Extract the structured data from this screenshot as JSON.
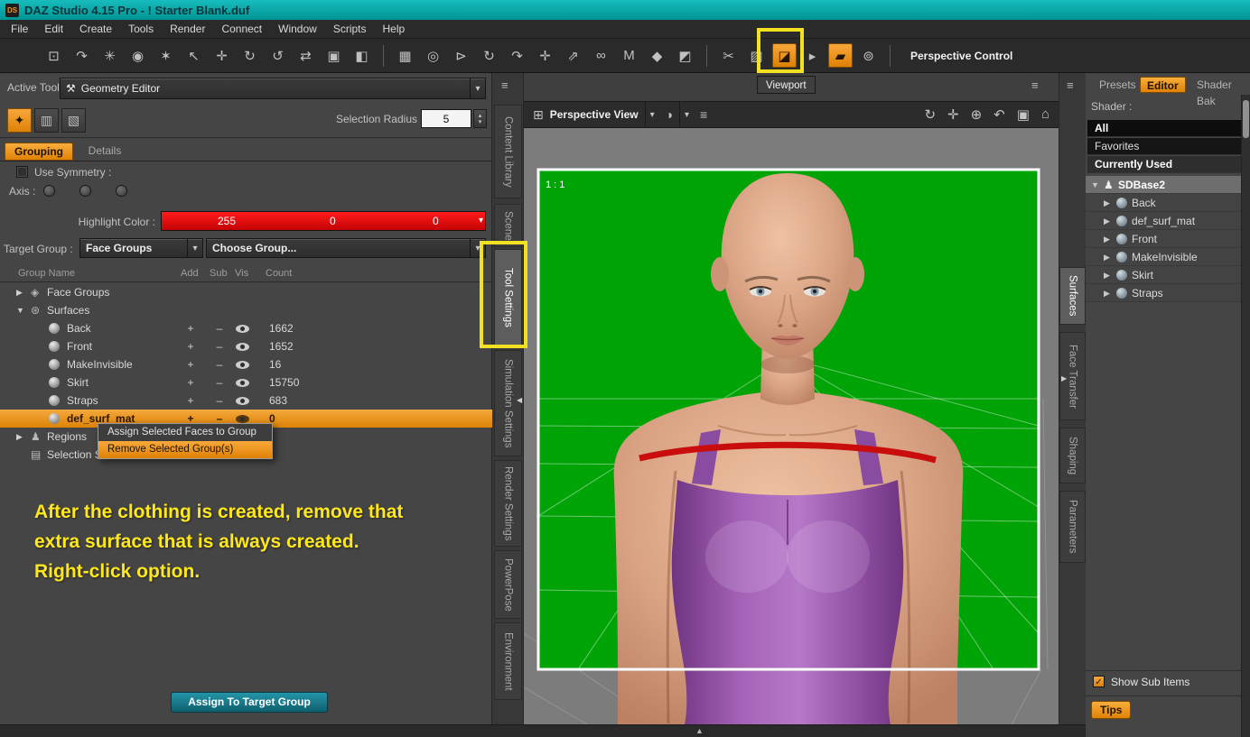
{
  "titlebar": {
    "app_badge": "DS",
    "title": "DAZ Studio 4.15 Pro - ! Starter Blank.duf"
  },
  "menubar": {
    "items": [
      "File",
      "Edit",
      "Create",
      "Tools",
      "Render",
      "Connect",
      "Window",
      "Scripts",
      "Help"
    ]
  },
  "toolbar": {
    "perspective_control": "Perspective Control",
    "icons": [
      {
        "name": "node-select",
        "glyph": "⊡"
      },
      {
        "name": "pose-tool",
        "glyph": "↷"
      },
      {
        "name": "spark-tool",
        "glyph": "✳"
      },
      {
        "name": "geoshell-tool",
        "glyph": "◉"
      },
      {
        "name": "wand-tool",
        "glyph": "✶"
      },
      {
        "name": "cursor-tool",
        "glyph": "↖"
      },
      {
        "name": "universal-tool",
        "glyph": "✛"
      },
      {
        "name": "rotate-cube-tool",
        "glyph": "↻"
      },
      {
        "name": "orbit-cube-tool",
        "glyph": "↺"
      },
      {
        "name": "translate-cube-tool",
        "glyph": "⇄"
      },
      {
        "name": "axis-cube-tool",
        "glyph": "▣"
      },
      {
        "name": "world-cube-tool",
        "glyph": "◧"
      },
      {
        "name": "grid-snap",
        "glyph": "▦"
      },
      {
        "name": "sphere-view",
        "glyph": "◎"
      },
      {
        "name": "select-arrow",
        "glyph": "⊳"
      },
      {
        "name": "rotate-tool",
        "glyph": "↻"
      },
      {
        "name": "twist-tool",
        "glyph": "↷"
      },
      {
        "name": "move-tool",
        "glyph": "✛"
      },
      {
        "name": "scale-tool",
        "glyph": "⇗"
      },
      {
        "name": "link-tool",
        "glyph": "∞"
      },
      {
        "name": "measure-tool",
        "glyph": "M"
      },
      {
        "name": "cube-figure-tool",
        "glyph": "◆"
      },
      {
        "name": "figure-pair-tool",
        "glyph": "◩"
      },
      {
        "name": "knife-tool",
        "glyph": "✂"
      },
      {
        "name": "hatch-tool",
        "glyph": "▨"
      },
      {
        "name": "geometry-editor",
        "glyph": "◪"
      },
      {
        "name": "flyout-arrow",
        "glyph": "▸"
      },
      {
        "name": "surface-selection",
        "glyph": "▰"
      },
      {
        "name": "camera-tool",
        "glyph": "⊚"
      }
    ]
  },
  "callout": {
    "viewport_label": "Viewport"
  },
  "glyphs": {
    "caret": "▾",
    "grid": "⊞",
    "sphere": "◑",
    "menu": "≡",
    "hamburger": "≡",
    "orbit": "↻",
    "pan": "✛",
    "zoom": "⊕",
    "undo": "↶",
    "frame": "▣",
    "home": "⌂",
    "tree_open": "▼",
    "tree_closed": "▶",
    "collapse_left": "◀",
    "collapse_right": "▶",
    "up_handle": "▲",
    "wrench": "⚒",
    "spin_up": "▴",
    "spin_down": "▾",
    "brush": "✦",
    "marquee": "▥",
    "lasso": "▧",
    "face_groups": "◈",
    "surfaces": "⊛",
    "person": "♟",
    "sets": "▤",
    "check": "✓"
  },
  "tool_settings": {
    "active_tool_label": "Active Tool :",
    "active_tool_value": "Geometry Editor",
    "selection_radius_label": "Selection Radius",
    "selection_radius_value": "5",
    "tab_grouping": "Grouping",
    "tab_details": "Details",
    "use_symmetry_label": "Use Symmetry :",
    "axis_label": "Axis :",
    "highlight_color_label": "Highlight Color :",
    "highlight_r": "255",
    "highlight_g": "0",
    "highlight_b": "0",
    "target_group_label": "Target Group :",
    "target_group_value": "Face Groups",
    "choose_group_value": "Choose Group...",
    "columns": {
      "name": "Group Name",
      "add": "Add",
      "sub": "Sub",
      "vis": "Vis",
      "count": "Count"
    },
    "rows": [
      {
        "label": "Face Groups"
      },
      {
        "label": "Surfaces"
      },
      {
        "label": "Back",
        "add": "+",
        "sub": "–",
        "count": "1662"
      },
      {
        "label": "Front",
        "add": "+",
        "sub": "–",
        "count": "1652"
      },
      {
        "label": "MakeInvisible",
        "add": "+",
        "sub": "–",
        "count": "16"
      },
      {
        "label": "Skirt",
        "add": "+",
        "sub": "–",
        "count": "15750"
      },
      {
        "label": "Straps",
        "add": "+",
        "sub": "–",
        "count": "683"
      },
      {
        "label": "def_surf_mat",
        "add": "+",
        "sub": "–",
        "count": "0"
      },
      {
        "label": "Regions"
      },
      {
        "label": "Selection S"
      }
    ],
    "context_menu": {
      "item1": "Assign Selected Faces to Group",
      "item2": "Remove Selected Group(s)"
    },
    "annotation": {
      "line1": "After the clothing is created, remove that",
      "line2": "extra surface that is always created.",
      "line3": "Right-click option."
    },
    "assign_button": "Assign To Target Group"
  },
  "left_dock": {
    "tabs": [
      "Content Library",
      "Scene",
      "Tool Settings",
      "Simulation Settings",
      "Render Settings",
      "PowerPose",
      "Environment"
    ]
  },
  "viewport": {
    "view_name": "Perspective View",
    "aspect_label": "1 : 1"
  },
  "right_dock": {
    "tabs": [
      "Surfaces",
      "Face Transfer",
      "Shaping",
      "Parameters"
    ]
  },
  "right_panel": {
    "tab_presets": "Presets",
    "tab_editor": "Editor",
    "tab_shader": "Shader Bak",
    "shader_label": "Shader :",
    "filters": [
      "All",
      "Favorites",
      "Currently Used"
    ],
    "root": "SDBase2",
    "items": [
      "Back",
      "def_surf_mat",
      "Front",
      "MakeInvisible",
      "Skirt",
      "Straps"
    ],
    "show_sub_items": "Show Sub Items",
    "tips": "Tips"
  },
  "colors": {
    "accent_orange": "#ee8e0d",
    "title_teal": "#00a7a7",
    "highlight_yellow": "#f2e120",
    "viewport_green": "#01a406",
    "marker_red": "#c90d0d",
    "button_teal": "#177a8c",
    "annotation_yellow": "#ffe81a"
  }
}
